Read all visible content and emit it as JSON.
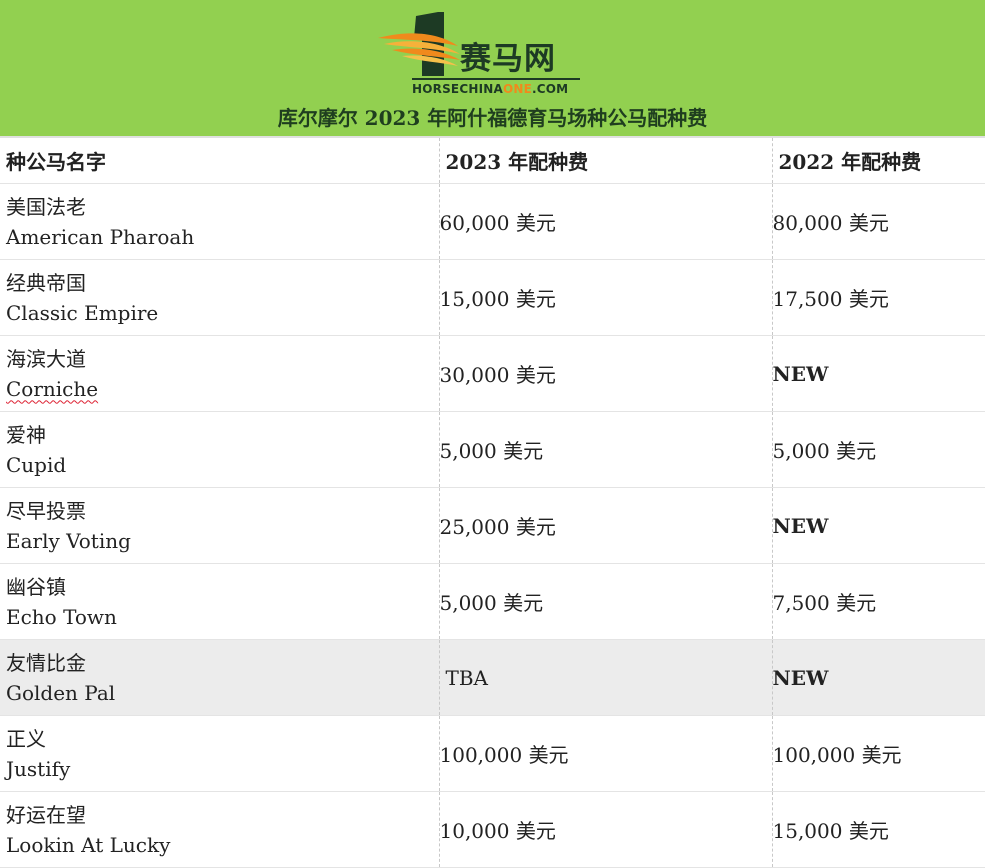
{
  "banner": {
    "logo_cn": "赛马网",
    "logo_en_prefix": "HORSECHINA",
    "logo_en_accent": "ONE",
    "logo_en_suffix": ".COM",
    "title": "库尔摩尔 2023 年阿什福德育马场种公马配种费",
    "colors": {
      "banner_bg": "#92d050",
      "logo_dark": "#1d3a24",
      "logo_accent": "#f08a1c"
    }
  },
  "table": {
    "headers": [
      "种公马名字",
      "2023 年配种费",
      "2022 年配种费"
    ],
    "rows": [
      {
        "name_cn": "美国法老",
        "name_en": "American Pharoah",
        "fee_2023": "60,000 美元",
        "fee_2022": "80,000 美元"
      },
      {
        "name_cn": "经典帝国",
        "name_en": "Classic Empire",
        "fee_2023": "15,000 美元",
        "fee_2022": "17,500 美元"
      },
      {
        "name_cn": "海滨大道",
        "name_en": "Corniche",
        "fee_2023": "30,000 美元",
        "fee_2022": "NEW"
      },
      {
        "name_cn": "爱神",
        "name_en": "Cupid",
        "fee_2023": "5,000 美元",
        "fee_2022": "5,000 美元"
      },
      {
        "name_cn": "尽早投票",
        "name_en": "Early Voting",
        "fee_2023": "25,000 美元",
        "fee_2022": "NEW"
      },
      {
        "name_cn": "幽谷镇",
        "name_en": "Echo Town",
        "fee_2023": "5,000 美元",
        "fee_2022": "7,500 美元"
      },
      {
        "name_cn": "友情比金",
        "name_en": "Golden Pal",
        "fee_2023": "TBA",
        "fee_2022": "NEW"
      },
      {
        "name_cn": "正义",
        "name_en": "Justify",
        "fee_2023": "100,000 美元",
        "fee_2022": "100,000 美元"
      },
      {
        "name_cn": "好运在望",
        "name_en": "Lookin At Lucky",
        "fee_2023": "10,000 美元",
        "fee_2022": "15,000 美元"
      }
    ]
  }
}
